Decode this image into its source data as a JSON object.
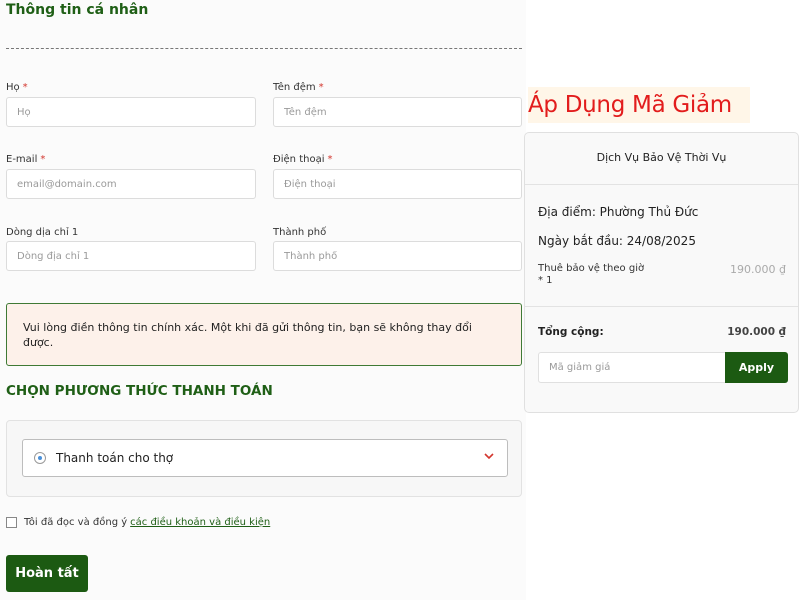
{
  "form": {
    "section_title": "Thông tin cá nhân",
    "fields": [
      {
        "label": "Họ",
        "required": "*",
        "placeholder": "Họ",
        "value": ""
      },
      {
        "label": "Tên đệm",
        "required": "*",
        "placeholder": "Tên đệm",
        "value": ""
      },
      {
        "label": "E-mail",
        "required": "*",
        "placeholder": "email@domain.com",
        "value": ""
      },
      {
        "label": "Điện thoại",
        "required": "*",
        "placeholder": "Điện thoại",
        "value": ""
      },
      {
        "label": "Dòng dịa chỉ 1",
        "required": "",
        "placeholder": "Dòng địa chỉ 1",
        "value": ""
      },
      {
        "label": "Thành phố",
        "required": "",
        "placeholder": "Thành phố",
        "value": ""
      }
    ],
    "notice": "Vui lòng điền thông tin chính xác. Một khi đã gửi thông tin, bạn sẽ không thay đổi được."
  },
  "payment": {
    "title": "CHỌN PHƯƠNG THỨC THANH TOÁN",
    "selected_method": "Thanh toán cho thợ",
    "icons": {
      "radio": "radio-selected-icon",
      "dropdown": "chevron-down-icon"
    },
    "accent_color": "#d3362e"
  },
  "terms": {
    "text": "Tôi đã đọc và đồng ý",
    "link": "các điều khoản và điều kiện"
  },
  "submit_label": "Hoàn tất",
  "promo_banner": "Áp Dụng Mã Giảm",
  "summary": {
    "title": "Dịch Vụ Bảo Vệ Thời Vụ",
    "location": "Địa điểm: Phường Thủ Đức",
    "start_date": "Ngày bắt đầu: 24/08/2025",
    "item_name": "Thuê bảo vệ theo giờ",
    "item_qty": "* 1",
    "item_price": "190.000 ₫",
    "total_label": "Tổng cộng:",
    "total_value": "190.000 ₫",
    "coupon_placeholder": "Mã giảm giá",
    "apply_label": "Apply"
  },
  "colors": {
    "brand_green": "#1c5a12",
    "heading_green": "#1f5f16",
    "required_red": "#d3362e",
    "banner_red": "#e21c1c",
    "notice_bg": "#fdf1ea"
  }
}
